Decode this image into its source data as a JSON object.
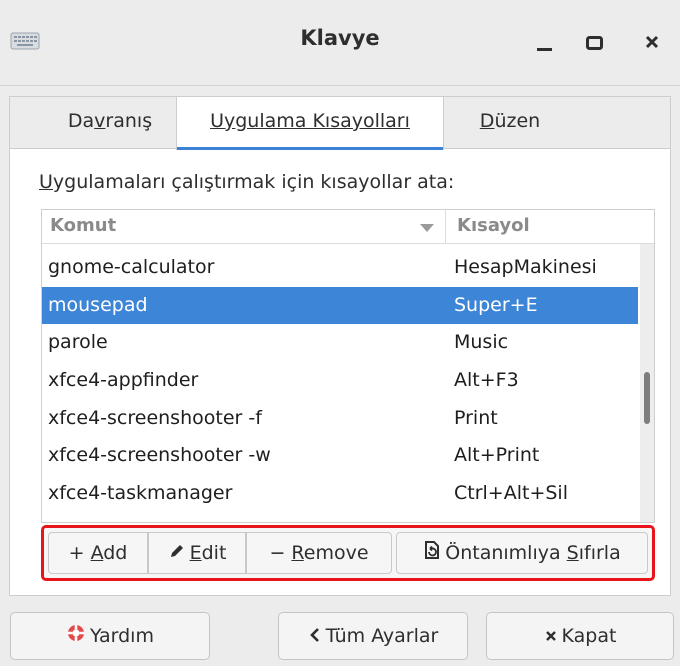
{
  "window": {
    "title": "Klavye"
  },
  "tabs": [
    {
      "pre": "Da",
      "u": "v",
      "post": "ranış"
    },
    {
      "pre": "",
      "u": "U",
      "post": "ygulama Kısayolları"
    },
    {
      "pre": "",
      "u": "D",
      "post": "üzen"
    }
  ],
  "active_tab": 1,
  "description": {
    "u": "U",
    "rest": "ygulamaları çalıştırmak için kısayollar ata:"
  },
  "table": {
    "headers": {
      "command": "Komut",
      "shortcut": "Kısayol"
    },
    "rows": [
      {
        "command": "gnome-calculator",
        "shortcut": "HesapMakinesi"
      },
      {
        "command": "mousepad",
        "shortcut": "Super+E",
        "selected": true
      },
      {
        "command": "parole",
        "shortcut": "Music"
      },
      {
        "command": "xfce4-appfinder",
        "shortcut": "Alt+F3"
      },
      {
        "command": "xfce4-screenshooter -f",
        "shortcut": "Print"
      },
      {
        "command": "xfce4-screenshooter -w",
        "shortcut": "Alt+Print"
      },
      {
        "command": "xfce4-taskmanager",
        "shortcut": "Ctrl+Alt+Sil"
      }
    ]
  },
  "buttons": {
    "add": {
      "symbol": "+",
      "u": "A",
      "rest": "dd"
    },
    "edit": {
      "u": "E",
      "rest": "dit"
    },
    "remove": {
      "symbol": "−",
      "u": "R",
      "rest": "emove"
    },
    "reset": {
      "pre": "Öntanımlıya ",
      "u": "S",
      "rest": "ıfırla"
    }
  },
  "footer": {
    "help": "Yardım",
    "all_settings": "Tüm Ayarlar",
    "close": "Kapat"
  },
  "colors": {
    "selection": "#3d85d6",
    "accent": "#3b82d6",
    "highlight_border": "#e8141b"
  }
}
